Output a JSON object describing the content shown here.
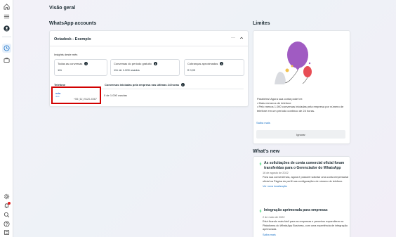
{
  "page": {
    "title": "Visão geral"
  },
  "accounts": {
    "section_title": "WhatsApp accounts",
    "account": {
      "name": "Octadesk - Exemplo",
      "menu_icon": "more-horizontal-icon",
      "collapse_icon": "chevron-up-icon",
      "insights_label": "Insights deste mês",
      "stats": [
        {
          "label": "Todas as conversas",
          "value": "111"
        },
        {
          "label": "Conversas do período gratuito",
          "value": "111 de 1.000 usados"
        },
        {
          "label": "Cobranças aproximadas",
          "value": "€ 0,00"
        }
      ],
      "columns": {
        "phone": "Telefone",
        "conversations": "Conversas iniciadas pela empresa nas últimas 24 horas"
      },
      "rows": [
        {
          "logo_text": "octa",
          "logo_sub": "desk",
          "phone": "+55 (11) 9120-4567",
          "usage": "0 de 1.000 usadas"
        }
      ]
    }
  },
  "limits": {
    "section_title": "Limites",
    "text": "Parabéns! Agora sua conta pode ter:",
    "bullets": [
      "• Mais números de telefone",
      "• Pelo menos 1.000 conversas iniciadas pela empresa por número de telefone em um período contínuo de 24 horas."
    ],
    "link": "Saiba mais",
    "ignore_button": "Ignorar",
    "colors": {
      "balloon_purple": "#a05bc2",
      "balloon_red": "#e84d55",
      "balloon_yellow": "#f3c24d",
      "background": "#d9dbe0"
    }
  },
  "news": {
    "section_title": "What's new",
    "items": [
      {
        "title": "As solicitações de conta comercial oficial foram transferidas para o Gerenciador do WhatsApp",
        "date": "16 de agosto de 2022",
        "body": "Para sua conveniência, agora é possível solicitar uma conta empresarial oficial na Página do perfil nas configurações de número de telefone.",
        "link": "Ver nova localização"
      },
      {
        "title": "Integração aprimorada para empresas",
        "date": "2 de maio de 2022",
        "body": "Está ficando mais fácil para as empresas e parceiros expandirem na Plataforma do WhatsApp Business, com uma experiência de integração aprimorada.",
        "link": "Saiba mais"
      }
    ]
  },
  "rail": {
    "icons": [
      "home-icon",
      "menu-icon",
      "account-avatar-icon",
      "clock-icon",
      "briefcase-icon",
      "settings-icon",
      "notifications-icon",
      "search-icon",
      "help-icon",
      "report-icon"
    ]
  },
  "colors": {
    "accent": "#1a73c8",
    "highlight_border": "#d10000",
    "news_icon": "#25d366"
  }
}
